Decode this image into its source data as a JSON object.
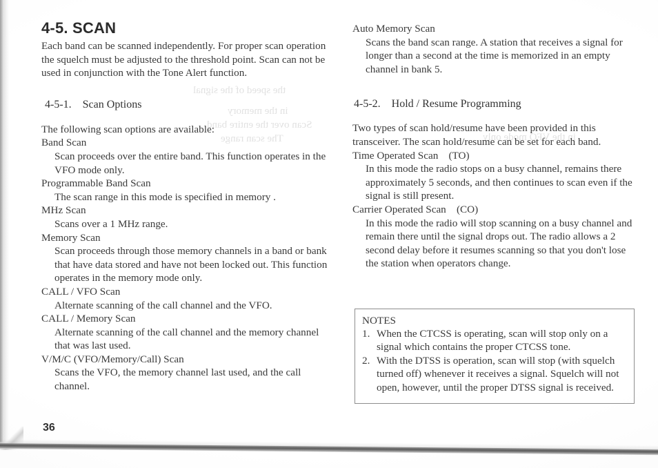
{
  "page": {
    "number": "36",
    "ghost_bleed": [
      "the speed of the signal",
      "in the memory",
      "Scan over the entire band",
      "The scan range",
      "in the VFO mode only"
    ]
  },
  "left_column": {
    "section_heading": "4-5. SCAN",
    "intro": "Each band can be scanned independently. For proper scan operation the squelch must be adjusted to the threshold point. Scan can not be used in conjunction with the Tone Alert function.",
    "subsection": {
      "number": "4-5-1.",
      "title": "Scan Options"
    },
    "lead_in": "The following scan options are available:",
    "options": [
      {
        "term": "Band Scan",
        "description": "Scan proceeds over the entire band. This function operates in the VFO mode only."
      },
      {
        "term": "Programmable Band Scan",
        "description": "The scan range in this mode is specified in memory ."
      },
      {
        "term": "MHz Scan",
        "description": "Scans over a 1 MHz range."
      },
      {
        "term": "Memory Scan",
        "description": "Scan proceeds through those memory channels in a band or bank that have data stored and have not been locked out. This function operates in the memory mode only."
      },
      {
        "term": "CALL / VFO Scan",
        "description": "Alternate scanning of the call channel and the VFO."
      },
      {
        "term": "CALL / Memory Scan",
        "description": "Alternate scanning of the call channel and the memory channel that was last used."
      },
      {
        "term": "V/M/C (VFO/Memory/Call) Scan",
        "description": "Scans the VFO, the memory channel last used, and the call channel."
      }
    ]
  },
  "right_column": {
    "auto_memory_scan": {
      "term": "Auto Memory Scan",
      "description": "Scans the band scan range. A station that receives a signal for longer than a second at the time is memorized in an empty channel in bank 5."
    },
    "subsection": {
      "number": "4-5-2.",
      "title": "Hold / Resume Programming"
    },
    "intro": "Two types of scan hold/resume have been provided in this transceiver. The scan hold/resume can be set for each band.",
    "modes": [
      {
        "term": "Time Operated Scan    (TO)",
        "description": "In this mode the radio stops on a busy channel, remains there approximately 5 seconds, and then continues to scan even if the signal is still present."
      },
      {
        "term": "Carrier Operated Scan    (CO)",
        "description": "In this mode the radio will stop scanning on a busy channel and remain there until the signal drops out. The radio allows a 2 second delay before it resumes scanning so that you don't lose the station when operators change."
      }
    ],
    "notes": {
      "heading": "NOTES",
      "items": [
        {
          "number": "1.",
          "text": "When the CTCSS is operating, scan will stop only on a signal which contains the proper CTCSS tone."
        },
        {
          "number": "2.",
          "text": "With the DTSS is operation, scan will stop (with squelch turned off) whenever it receives a signal. Squelch will not open, however, until the proper DTSS signal is received."
        }
      ]
    }
  }
}
